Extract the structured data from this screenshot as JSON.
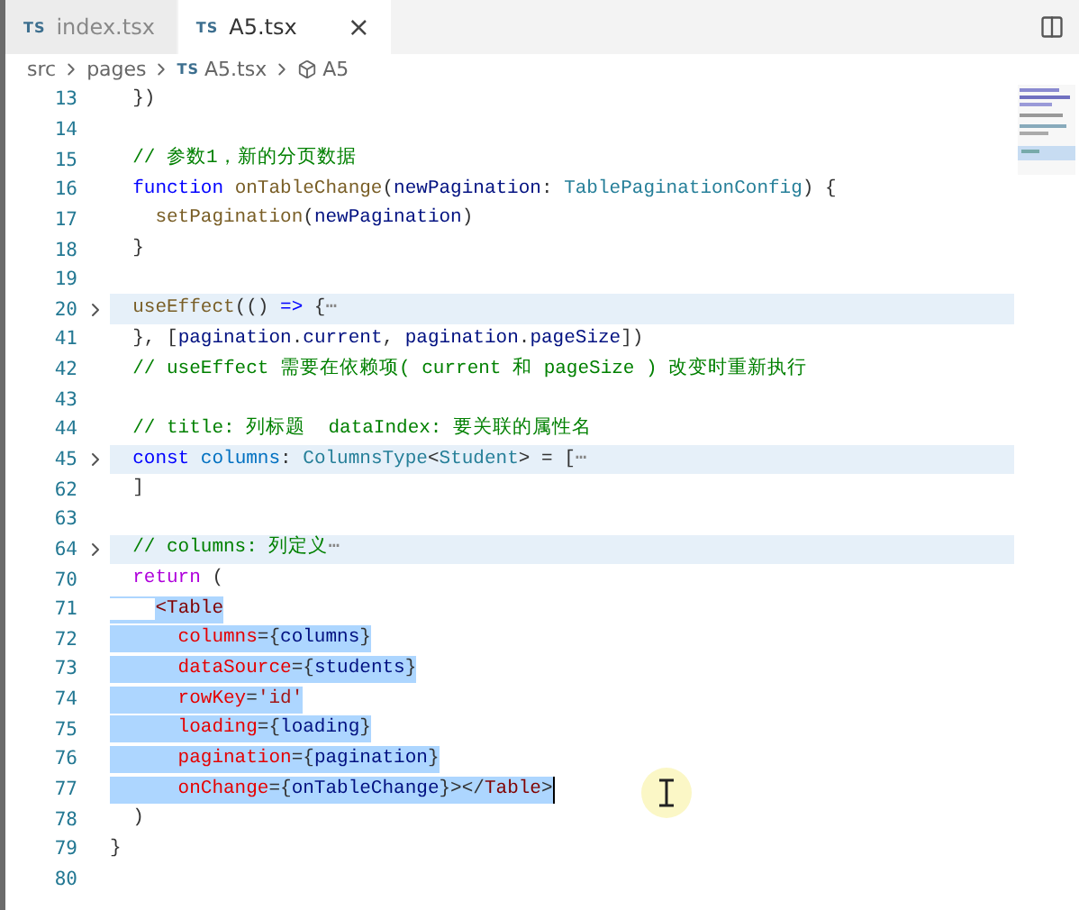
{
  "tabs": [
    {
      "label": "index.tsx",
      "badge": "TS",
      "selected": false
    },
    {
      "label": "A5.tsx",
      "badge": "TS",
      "selected": true,
      "close": "×"
    }
  ],
  "breadcrumb": [
    {
      "kind": "folder",
      "label": "src"
    },
    {
      "kind": "folder",
      "label": "pages"
    },
    {
      "kind": "file",
      "badge": "TS",
      "label": "A5.tsx"
    },
    {
      "kind": "symbol",
      "label": "A5"
    }
  ],
  "lines": [
    {
      "number": "13",
      "selected": false,
      "tokens": [
        {
          "kind": "plain",
          "text": "  })"
        }
      ]
    },
    {
      "number": "14",
      "selected": false
    },
    {
      "number": "15",
      "selected": false,
      "tokens": [
        {
          "kind": "comment",
          "text": "  // 参数1，新的分页数据"
        }
      ]
    },
    {
      "number": "16",
      "selected": false,
      "tokens": [
        {
          "kind": "keyword",
          "text": "  function"
        },
        {
          "kind": "function",
          "text": " onTableChange"
        },
        {
          "kind": "plain",
          "text": "("
        },
        {
          "kind": "variable",
          "text": "newPagination"
        },
        {
          "kind": "plain",
          "text": ":"
        },
        {
          "kind": "type",
          "text": " TablePaginationConfig"
        },
        {
          "kind": "plain",
          "text": ") {"
        }
      ]
    },
    {
      "number": "17",
      "selected": false,
      "tokens": [
        {
          "kind": "function",
          "text": "    setPagination"
        },
        {
          "kind": "plain",
          "text": "("
        },
        {
          "kind": "variable",
          "text": "newPagination"
        },
        {
          "kind": "plain",
          "text": ")"
        }
      ]
    },
    {
      "number": "18",
      "selected": false,
      "tokens": [
        {
          "kind": "plain",
          "text": "  }"
        }
      ]
    },
    {
      "number": "19",
      "selected": false
    },
    {
      "number": "20",
      "selected": false,
      "folded": true,
      "tokens": [
        {
          "kind": "function",
          "text": "  useEffect"
        },
        {
          "kind": "plain",
          "text": "(()"
        },
        {
          "kind": "keyword",
          "text": " =>"
        },
        {
          "kind": "plain",
          "text": " {"
        },
        {
          "kind": "fold",
          "text": "⋯"
        }
      ]
    },
    {
      "number": "41",
      "selected": false,
      "tokens": [
        {
          "kind": "plain",
          "text": "  }, ["
        },
        {
          "kind": "variable",
          "text": "pagination"
        },
        {
          "kind": "plain",
          "text": "."
        },
        {
          "kind": "variable",
          "text": "current"
        },
        {
          "kind": "plain",
          "text": ","
        },
        {
          "kind": "variable",
          "text": " pagination"
        },
        {
          "kind": "plain",
          "text": "."
        },
        {
          "kind": "variable",
          "text": "pageSize"
        },
        {
          "kind": "plain",
          "text": "])"
        }
      ]
    },
    {
      "number": "42",
      "selected": false,
      "tokens": [
        {
          "kind": "comment",
          "text": "  // useEffect 需要在依赖项( current 和 pageSize ) 改变时重新执行"
        }
      ]
    },
    {
      "number": "43",
      "selected": false
    },
    {
      "number": "44",
      "selected": false,
      "tokens": [
        {
          "kind": "comment",
          "text": "  // title: 列标题  dataIndex: 要关联的属性名"
        }
      ]
    },
    {
      "number": "45",
      "selected": false,
      "folded": true,
      "tokens": [
        {
          "kind": "keyword",
          "text": "  const"
        },
        {
          "kind": "constant",
          "text": " columns"
        },
        {
          "kind": "plain",
          "text": ":"
        },
        {
          "kind": "type",
          "text": " ColumnsType"
        },
        {
          "kind": "plain",
          "text": "<"
        },
        {
          "kind": "type",
          "text": "Student"
        },
        {
          "kind": "plain",
          "text": "> = ["
        },
        {
          "kind": "fold",
          "text": "⋯"
        }
      ]
    },
    {
      "number": "62",
      "selected": false,
      "tokens": [
        {
          "kind": "plain",
          "text": "  ]"
        }
      ]
    },
    {
      "number": "63",
      "selected": false
    },
    {
      "number": "64",
      "selected": false,
      "folded": true,
      "tokens": [
        {
          "kind": "comment",
          "text": "  // columns: 列定义"
        },
        {
          "kind": "fold",
          "text": "⋯"
        }
      ]
    },
    {
      "number": "70",
      "selected": false,
      "tokens": [
        {
          "kind": "control",
          "text": "  return"
        },
        {
          "kind": "plain",
          "text": " ("
        }
      ]
    },
    {
      "number": "71",
      "selected": true,
      "from_indent": true,
      "tokens": [
        {
          "kind": "tag",
          "text": "    <Table"
        }
      ]
    },
    {
      "number": "72",
      "selected": true,
      "tokens": [
        {
          "kind": "attr",
          "text": "      columns"
        },
        {
          "kind": "plain",
          "text": "={"
        },
        {
          "kind": "variable",
          "text": "columns"
        },
        {
          "kind": "plain",
          "text": "}"
        }
      ]
    },
    {
      "number": "73",
      "selected": true,
      "tokens": [
        {
          "kind": "attr",
          "text": "      dataSource"
        },
        {
          "kind": "plain",
          "text": "={"
        },
        {
          "kind": "variable",
          "text": "students"
        },
        {
          "kind": "plain",
          "text": "}"
        }
      ]
    },
    {
      "number": "74",
      "selected": true,
      "tokens": [
        {
          "kind": "attr",
          "text": "      rowKey"
        },
        {
          "kind": "plain",
          "text": "="
        },
        {
          "kind": "string",
          "text": "'id'"
        }
      ]
    },
    {
      "number": "75",
      "selected": true,
      "tokens": [
        {
          "kind": "attr",
          "text": "      loading"
        },
        {
          "kind": "plain",
          "text": "={"
        },
        {
          "kind": "variable",
          "text": "loading"
        },
        {
          "kind": "plain",
          "text": "}"
        }
      ]
    },
    {
      "number": "76",
      "selected": true,
      "tokens": [
        {
          "kind": "attr",
          "text": "      pagination"
        },
        {
          "kind": "plain",
          "text": "={"
        },
        {
          "kind": "variable",
          "text": "pagination"
        },
        {
          "kind": "plain",
          "text": "}"
        }
      ]
    },
    {
      "number": "77",
      "selected": true,
      "cursor": true,
      "tokens": [
        {
          "kind": "attr",
          "text": "      onChange"
        },
        {
          "kind": "plain",
          "text": "={"
        },
        {
          "kind": "variable",
          "text": "onTableChange"
        },
        {
          "kind": "plain",
          "text": "}></"
        },
        {
          "kind": "tag",
          "text": "Table"
        },
        {
          "kind": "plain",
          "text": ">"
        }
      ]
    },
    {
      "number": "78",
      "selected": false,
      "tokens": [
        {
          "kind": "plain",
          "text": "  )"
        }
      ]
    },
    {
      "number": "79",
      "selected": false,
      "tokens": [
        {
          "kind": "plain",
          "text": "}"
        }
      ]
    },
    {
      "number": "80",
      "selected": false
    }
  ]
}
